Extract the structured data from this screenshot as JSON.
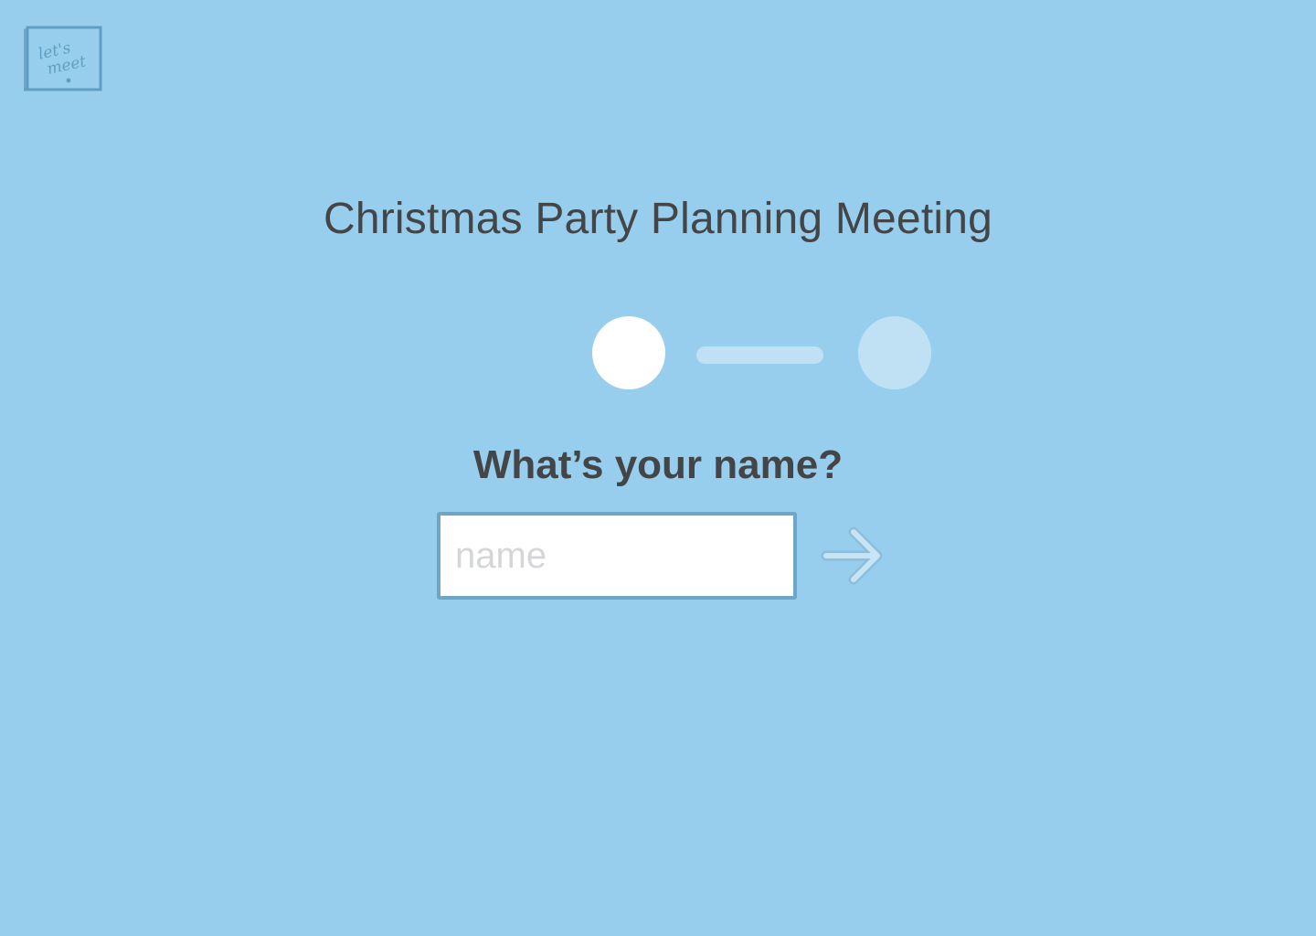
{
  "app": {
    "logo_text_line1": "let's",
    "logo_text_line2": "meet"
  },
  "event": {
    "title": "Christmas Party Planning Meeting"
  },
  "stepper": {
    "total_steps": 2,
    "current_step": 1
  },
  "form": {
    "question": "What’s your name?",
    "name_placeholder": "name",
    "name_value": "",
    "next_icon": "arrow-right-icon"
  },
  "colors": {
    "background": "#98CEED",
    "text": "#444547",
    "step_active": "#FFFFFF",
    "step_inactive": "#C0E1F4",
    "input_border": "#6FA6C8",
    "logo": "#5F9EC2"
  }
}
